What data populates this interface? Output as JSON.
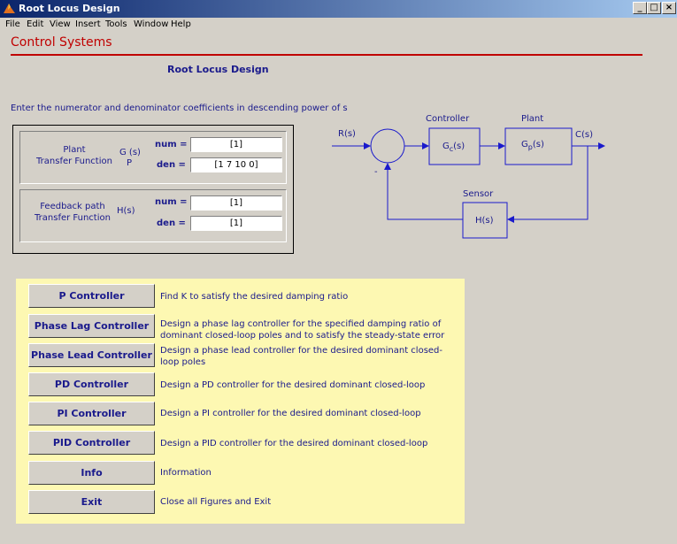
{
  "window": {
    "title": "Root Locus Design",
    "controls": [
      "_",
      "□",
      "×"
    ]
  },
  "menu": [
    "File",
    "Edit",
    "View",
    "Insert",
    "Tools",
    "Window",
    "Help"
  ],
  "header": {
    "title": "Control Systems",
    "subtitle": "Root Locus Design",
    "instruction": "Enter the numerator and denominator coefficients in descending power of s"
  },
  "plant": {
    "label_line1": "Plant",
    "label_line2": "Transfer Function",
    "symbol_main": "G (s)",
    "symbol_sub": "P",
    "num_label": "num =",
    "num_value": "[1]",
    "den_label": "den =",
    "den_value": "[1 7 10 0]"
  },
  "feedback": {
    "label_line1": "Feedback path",
    "label_line2": "Transfer Function",
    "symbol": "H(s)",
    "num_label": "num =",
    "num_value": "[1]",
    "den_label": "den =",
    "den_value": "[1]"
  },
  "diagram": {
    "input": "R(s)",
    "output": "C(s)",
    "controller_title": "Controller",
    "controller_main": "G",
    "controller_sub": "c",
    "controller_tail": "(s)",
    "plant_title": "Plant",
    "plant_main": "G",
    "plant_sub": "p",
    "plant_tail": "(s)",
    "sensor_title": "Sensor",
    "sensor_block": "H(s)",
    "minus": "-"
  },
  "controllers": [
    {
      "label": "P Controller",
      "desc": "Find K to satisfy the desired damping ratio"
    },
    {
      "label": "Phase Lag Controller",
      "desc": "Design a phase lag controller for the specified damping ratio of dominant closed-loop poles and to satisfy the steady-state error"
    },
    {
      "label": "Phase Lead Controller",
      "desc": "Design a phase lead controller for the desired dominant closed-loop poles"
    },
    {
      "label": "PD Controller",
      "desc": "Design a PD controller for the desired dominant closed-loop"
    },
    {
      "label": "PI Controller",
      "desc": "Design a PI controller for the desired dominant closed-loop"
    },
    {
      "label": "PID Controller",
      "desc": "Design a PID controller for the desired dominant closed-loop"
    },
    {
      "label": "Info",
      "desc": "Information"
    },
    {
      "label": "Exit",
      "desc": "Close all Figures and Exit"
    }
  ],
  "colors": {
    "text_blue": "#1a1a8c",
    "heading_red": "#c00000",
    "panel_yellow": "#fdf8b2",
    "diagram_blue": "#1a1acc",
    "background": "#d4d0c8"
  }
}
